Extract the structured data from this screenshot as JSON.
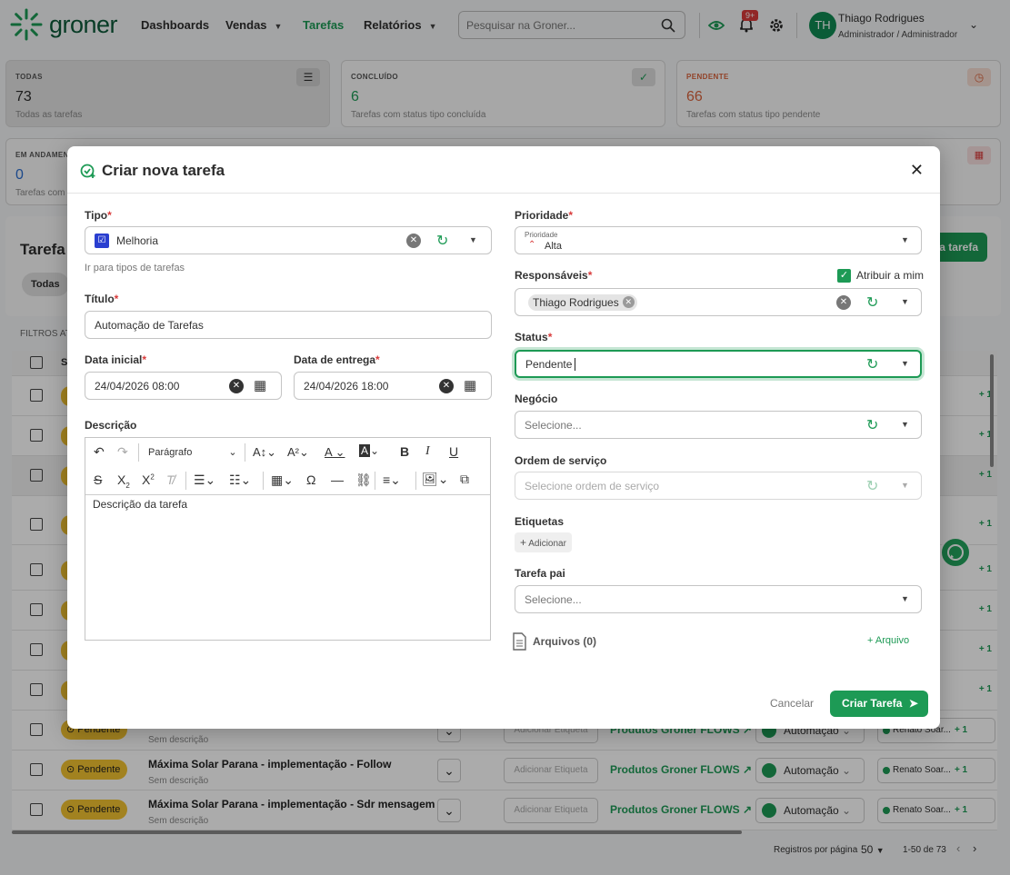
{
  "nav": {
    "logo": "groner",
    "links": [
      "Dashboards",
      "Vendas",
      "Tarefas",
      "Relatórios"
    ],
    "search_placeholder": "Pesquisar na Groner...",
    "notif_badge": "9+",
    "user_name": "Thiago Rodrigues",
    "user_role": "Administrador / Administrador",
    "avatar": "TH"
  },
  "stats": [
    {
      "label": "TODAS",
      "value": "73",
      "sub": "Todas as tarefas"
    },
    {
      "label": "CONCLUÍDO",
      "value": "6",
      "sub": "Tarefas com status tipo concluída"
    },
    {
      "label": "PENDENTE",
      "value": "66",
      "sub": "Tarefas com status tipo pendente"
    },
    {
      "label": "EM ANDAMEN",
      "value": "0",
      "sub": "Tarefas com"
    }
  ],
  "background": {
    "section_title": "Tarefa",
    "filter_tab": "Todas",
    "filters_label": "FILTROS AT",
    "new_task_btn": "a tarefa",
    "col_s": "S",
    "status_pill": "Pendente",
    "product": "Produtos Groner FLOWS",
    "tag_btn": "Adicionar Etiqueta",
    "category": "Automação",
    "responsible": "Renato Soar...",
    "plus": "+ 1",
    "no_desc": "Sem descrição",
    "rows": [
      {
        "title": "",
        "sub": "Sem descrição"
      },
      {
        "title": "Máxima Solar Parana - implementação - Follow",
        "sub": "Sem descrição"
      },
      {
        "title": "Máxima Solar Parana - implementação - Sdr mensagem",
        "sub": "Sem descrição"
      }
    ],
    "pagination": {
      "label": "Registros por página",
      "per_page": "50",
      "range": "1-50 de 73"
    }
  },
  "modal": {
    "title": "Criar nova tarefa",
    "tipo": {
      "label": "Tipo",
      "value": "Melhoria",
      "hint": "Ir para tipos de tarefas"
    },
    "titulo": {
      "label": "Título",
      "value": "Automação de Tarefas"
    },
    "data_inicial": {
      "label": "Data inicial",
      "value": "24/04/2026 08:00"
    },
    "data_entrega": {
      "label": "Data de entrega",
      "value": "24/04/2026 18:00"
    },
    "descricao": {
      "label": "Descrição",
      "paragraph": "Parágrafo",
      "placeholder": "Descrição da tarefa"
    },
    "prioridade": {
      "label": "Prioridade",
      "mini_label": "Prioridade",
      "value": "Alta"
    },
    "responsaveis": {
      "label": "Responsáveis",
      "assign_me": "Atribuir a mim",
      "chip": "Thiago Rodrigues"
    },
    "status": {
      "label": "Status",
      "value": "Pendente"
    },
    "negocio": {
      "label": "Negócio",
      "placeholder": "Selecione..."
    },
    "ordem": {
      "label": "Ordem de serviço",
      "placeholder": "Selecione ordem de serviço"
    },
    "etiquetas": {
      "label": "Etiquetas",
      "add": "Adicionar"
    },
    "tarefa_pai": {
      "label": "Tarefa pai",
      "placeholder": "Selecione..."
    },
    "arquivos": {
      "label": "Arquivos (0)",
      "add": "Arquivo"
    },
    "cancel": "Cancelar",
    "create": "Criar Tarefa"
  },
  "colors": {
    "brand": "#1d9a55",
    "pending": "#f2c230",
    "required": "#d93b3b",
    "priority_high": "#d93b3b"
  }
}
